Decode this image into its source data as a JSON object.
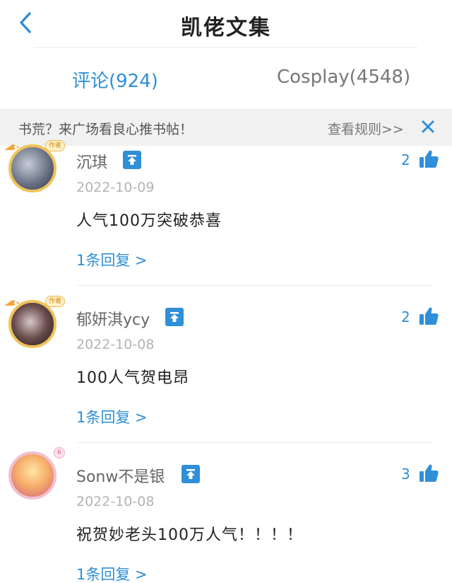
{
  "header": {
    "title": "凯佬文集"
  },
  "tabs": [
    {
      "label": "评论(924)",
      "active": true
    },
    {
      "label": "Cosplay(4548)",
      "active": false
    }
  ],
  "notice": {
    "text": "书荒？来广场看良心推书帖！",
    "link": "查看规则>>"
  },
  "comments": [
    {
      "username": "沉琪",
      "date": "2022-10-09",
      "content": "人气100万突破恭喜",
      "replies": "1条回复 >",
      "likes": "2",
      "avatar_badge": "作者"
    },
    {
      "username": "郁妍淇ycy",
      "date": "2022-10-08",
      "content": "100人气贺电昂",
      "replies": "1条回复 >",
      "likes": "2",
      "avatar_badge": "作者"
    },
    {
      "username": "Sonw不是银",
      "date": "2022-10-08",
      "content": "祝贺妙老头100万人气！！！！",
      "replies": "1条回复 >",
      "likes": "3",
      "avatar_badge": "6"
    }
  ],
  "colors": {
    "accent": "#2f8fd8",
    "muted": "#b3b3b3",
    "notice_bg": "#f1f1f1"
  }
}
